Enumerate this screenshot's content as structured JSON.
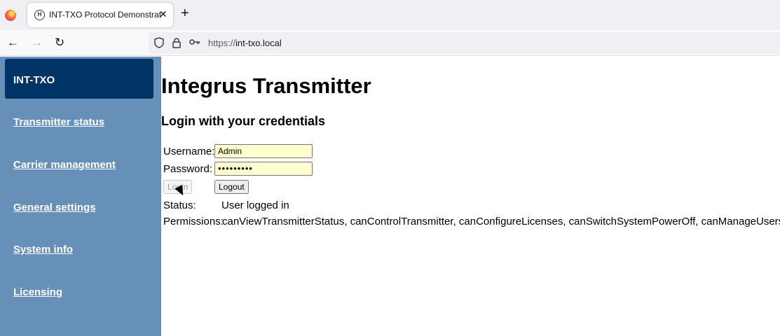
{
  "browser": {
    "tab_title": "INT-TXO Protocol Demonstrator",
    "tab_close": "✕",
    "new_tab": "+",
    "back": "←",
    "forward": "→",
    "reload": "↻",
    "url_scheme": "https://",
    "url_host": "int-txo.local"
  },
  "sidebar": {
    "brand": "INT-TXO",
    "items": [
      {
        "label": "Transmitter status"
      },
      {
        "label": "Carrier management"
      },
      {
        "label": "General settings"
      },
      {
        "label": "System info"
      },
      {
        "label": "Licensing"
      }
    ]
  },
  "main": {
    "title": "Integrus Transmitter",
    "subtitle": "Login with your credentials",
    "username_label": "Username:",
    "username_value": "Admin",
    "password_label": "Password:",
    "password_value": "•••••••••",
    "login_button": "Login",
    "logout_button": "Logout",
    "status_label": "Status:",
    "status_value": "User logged in",
    "permissions_label": "Permissions:",
    "permissions_value": "canViewTransmitterStatus, canControlTransmitter, canConfigureLicenses, canSwitchSystemPowerOff, canManageUsers"
  },
  "icons": {
    "shield": "shield-icon",
    "lock": "lock-icon",
    "key": "key-icon"
  }
}
